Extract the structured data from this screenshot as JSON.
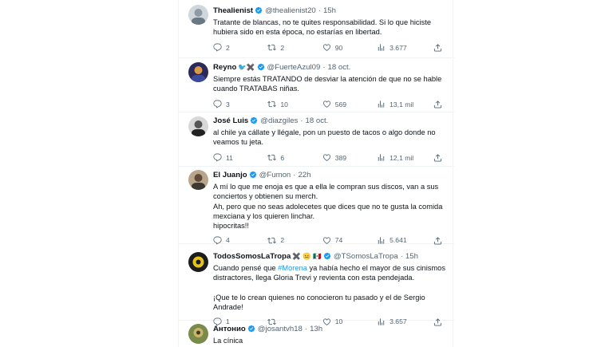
{
  "tweets": [
    {
      "name": "Thealienist",
      "handle": "@thealienist20",
      "time": "15h",
      "lines": [
        "Tratante de blancas, no te quites responsabilidad. Si lo que hiciste hubiera sido en esta época, no estarías en libertad."
      ],
      "replies": "2",
      "retweets": "2",
      "likes": "90",
      "views": "3.677"
    },
    {
      "name": "Reyno",
      "handle": "@FuerteAzul09",
      "time": "18 oct.",
      "lines": [
        "Siempre estás TRATANDO de desviar la atención de que no se hable cuando TRATABAS niñas."
      ],
      "replies": "3",
      "retweets": "10",
      "likes": "569",
      "views": "13,1 mil"
    },
    {
      "name": "José Luis",
      "handle": "@diazgiles",
      "time": "18 oct.",
      "lines": [
        "al chile ya cállate y llégale, pon un puesto de tacos o algo donde no veamos tu jeta."
      ],
      "replies": "11",
      "retweets": "6",
      "likes": "389",
      "views": "12,1 mil"
    },
    {
      "name": "El Juanjo",
      "handle": "@Fumon",
      "time": "22h",
      "lines": [
        "A mí lo que me enoja es que a ella le compran sus discos, van a sus conciertos y obtienen su merch.",
        "Ah, pero que no seas adolecetes que dices que no te gusta la comida mexciana y los quieren linchar.",
        "hipocritas!!"
      ],
      "replies": "4",
      "retweets": "2",
      "likes": "74",
      "views": "5.641"
    },
    {
      "name": "TodosSomosLaTropa",
      "handle": "@TSomosLaTropa",
      "time": "15h",
      "text_before": "Cuando pensé que ",
      "hashtag": "#Morena",
      "text_after": " ya había hecho el mayor de sus cinismos distractores, llega Gloria Trevi y revienta con esta pendejada.",
      "line2": "¡Que te lo crean quienes no conocieron tu pasado y el de Sergio Andrade!",
      "replies": "1",
      "retweets": "",
      "likes": "10",
      "views": "3.657"
    },
    {
      "name": "Антонио",
      "handle": "@josantvh18",
      "time": "13h",
      "lines": [
        "La cínica"
      ]
    }
  ],
  "icons": {
    "reply": "reply-icon",
    "retweet": "retweet-icon",
    "like": "heart-icon",
    "views": "views-icon",
    "share": "share-icon",
    "verified": "verified-badge-icon"
  },
  "colors": {
    "verified": "#1d9bf0",
    "muted": "#536471",
    "hashtag": "#1d9bf0",
    "divider": "#eff3f4"
  }
}
